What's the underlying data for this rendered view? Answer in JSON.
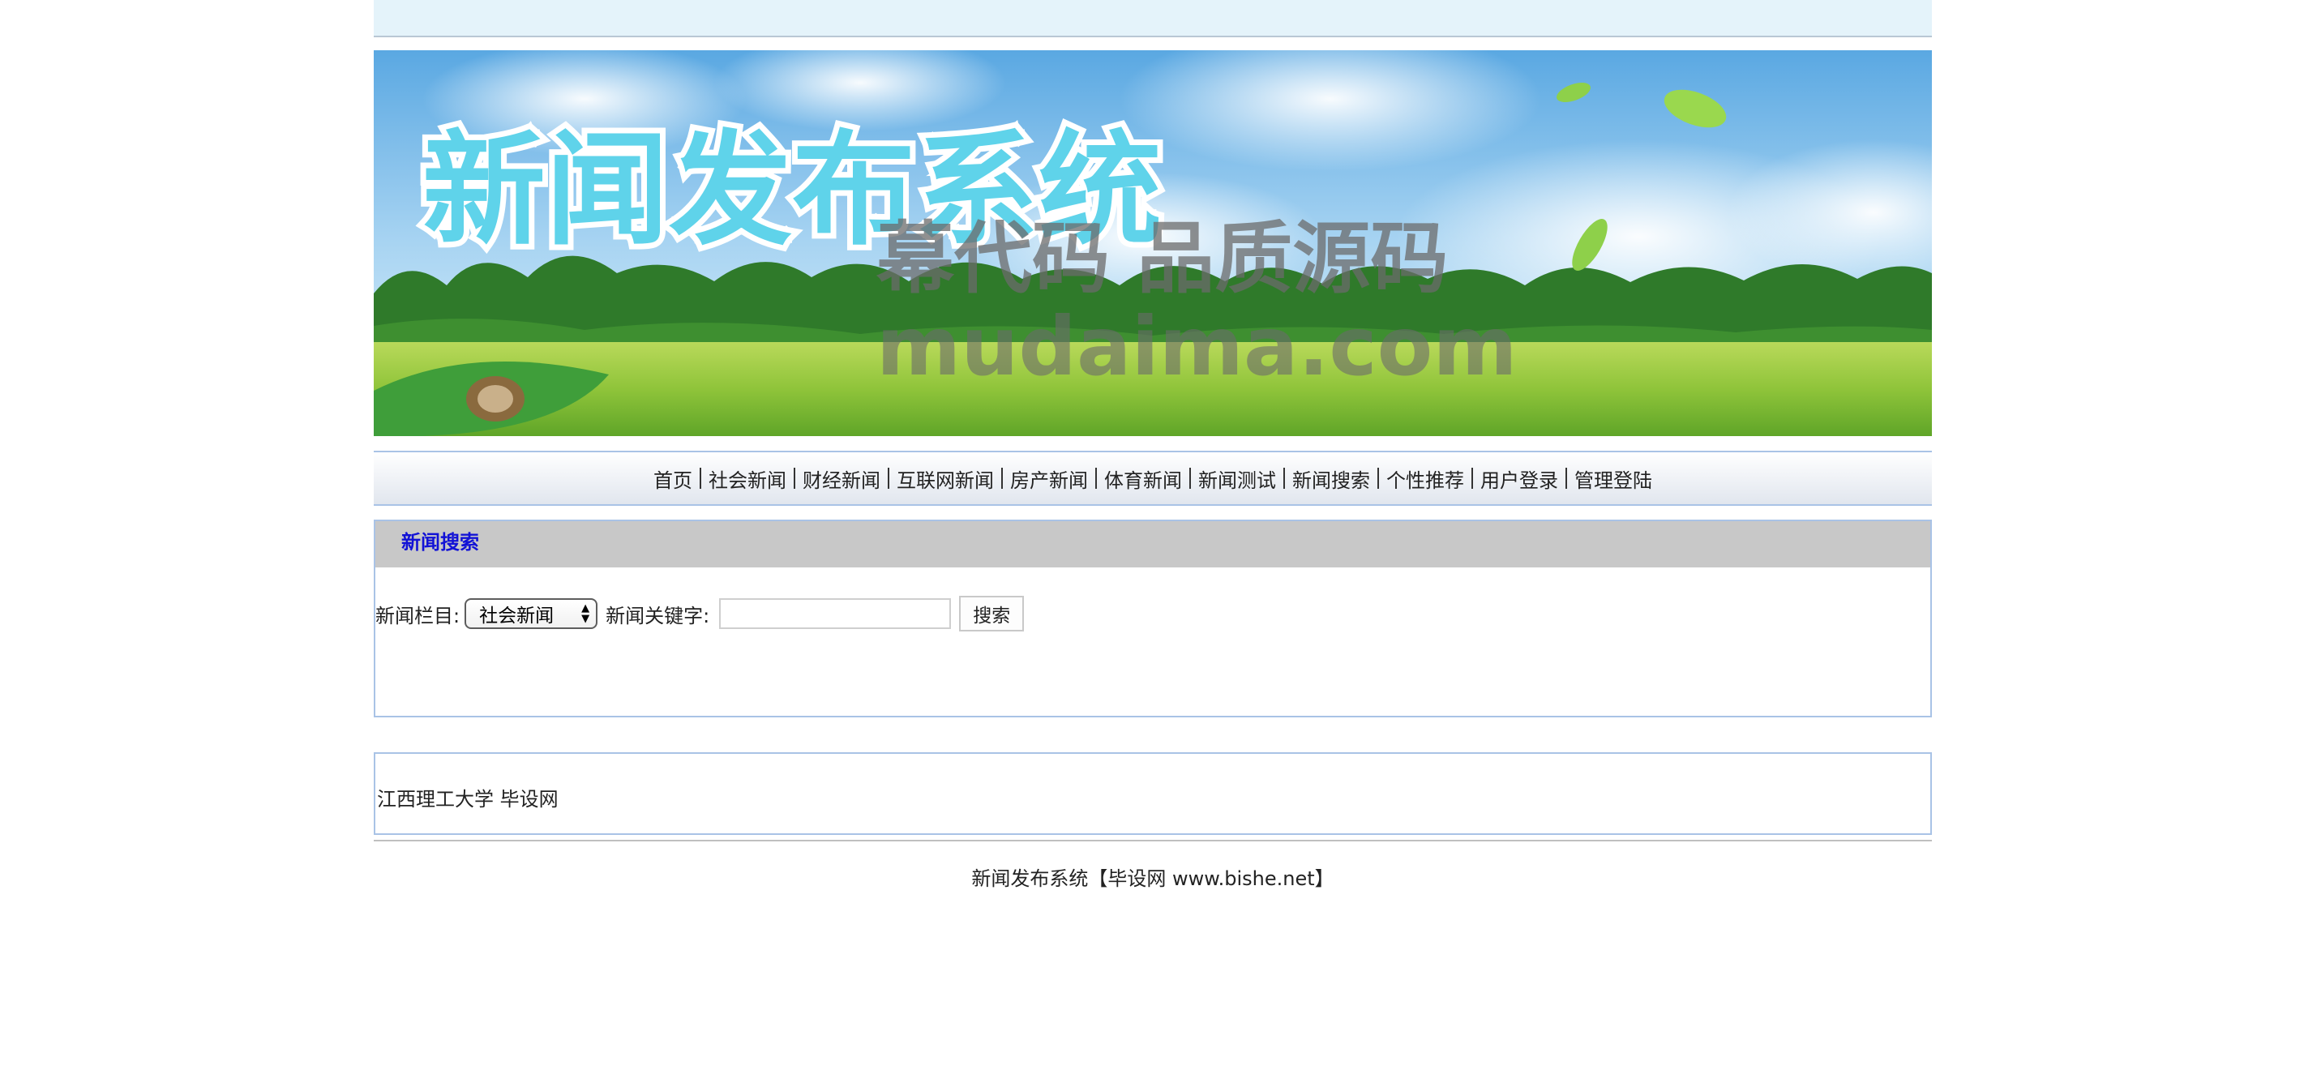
{
  "header": {
    "banner_title": "新闻发布系统",
    "watermark_line1": "幕代码 品质源码",
    "watermark_line2": "mudaima.com"
  },
  "nav": {
    "items": [
      {
        "label": "首页"
      },
      {
        "label": "社会新闻"
      },
      {
        "label": "财经新闻"
      },
      {
        "label": "互联网新闻"
      },
      {
        "label": "房产新闻"
      },
      {
        "label": "体育新闻"
      },
      {
        "label": "新闻测试"
      },
      {
        "label": "新闻搜索"
      },
      {
        "label": "个性推荐"
      },
      {
        "label": "用户登录"
      },
      {
        "label": "管理登陆"
      }
    ]
  },
  "search_panel": {
    "title": "新闻搜索",
    "category_label": "新闻栏目:",
    "category_selected": "社会新闻",
    "keyword_label": "新闻关键字:",
    "keyword_value": "",
    "search_button": "搜索"
  },
  "info": {
    "text": "江西理工大学 毕设网"
  },
  "footer": {
    "text": "新闻发布系统【毕设网 www.bishe.net】"
  },
  "colors": {
    "panel_title": "#1212d6",
    "border": "#a9c3e6",
    "topbar": "#e4f3fa",
    "banner_title": "#5fd3ea"
  }
}
